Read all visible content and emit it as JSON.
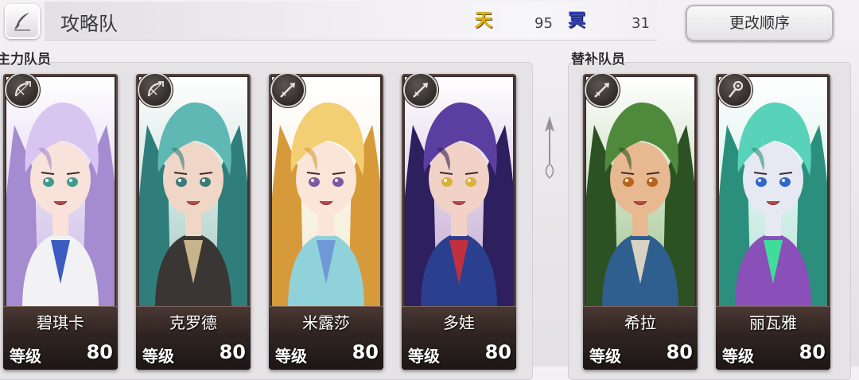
{
  "header": {
    "title": "攻略队",
    "resources": [
      {
        "glyph": "天",
        "icon": "heaven-resource-icon",
        "value": "95"
      },
      {
        "glyph": "冥",
        "icon": "nether-resource-icon",
        "value": "31"
      }
    ],
    "reorder_label": "更改顺序"
  },
  "sections": {
    "main_label": "主力队员",
    "sub_label": "替补队员"
  },
  "level_label": "等级",
  "characters": [
    {
      "name": "碧琪卡",
      "level": "80",
      "class_icon": "bow-icon",
      "hair": "#d9c6f0",
      "hair_dark": "#a58bcf",
      "skin": "#f8e2da",
      "eyes": "#3f9c8c",
      "outfit": "#f2f2f5",
      "outfit2": "#3d5cc2",
      "bg": "#c9b6e6"
    },
    {
      "name": "克罗德",
      "level": "80",
      "class_icon": "bow-icon",
      "hair": "#5fb8b4",
      "hair_dark": "#2f7e7c",
      "skin": "#f0d6c6",
      "eyes": "#3a7a78",
      "outfit": "#3a3633",
      "outfit2": "#c8b48a",
      "bg": "#9fc9c0"
    },
    {
      "name": "米露莎",
      "level": "80",
      "class_icon": "spear-icon",
      "hair": "#f2cf72",
      "hair_dark": "#d79a3a",
      "skin": "#fbe4d8",
      "eyes": "#7a5aa0",
      "outfit": "#8fd2d9",
      "outfit2": "#6e98d6",
      "bg": "#f4ead2"
    },
    {
      "name": "多娃",
      "level": "80",
      "class_icon": "spear-icon",
      "hair": "#5b3fa0",
      "hair_dark": "#2e1f5e",
      "skin": "#f2d2c6",
      "eyes": "#d9b23a",
      "outfit": "#2b3f8f",
      "outfit2": "#c03040",
      "bg": "#bfa2cf"
    },
    {
      "name": "希拉",
      "level": "80",
      "class_icon": "spear-icon",
      "hair": "#4f8a3c",
      "hair_dark": "#2c5224",
      "skin": "#e8b890",
      "eyes": "#b5651d",
      "outfit": "#2f5f8f",
      "outfit2": "#d8d2c2",
      "bg": "#9cc08a"
    },
    {
      "name": "丽瓦雅",
      "level": "80",
      "class_icon": "staff-icon",
      "hair": "#58d2b8",
      "hair_dark": "#2c8f7d",
      "skin": "#e6e8f4",
      "eyes": "#2f68c9",
      "outfit": "#8a4fb8",
      "outfit2": "#3fdc9a",
      "bg": "#b3e3d8"
    }
  ]
}
